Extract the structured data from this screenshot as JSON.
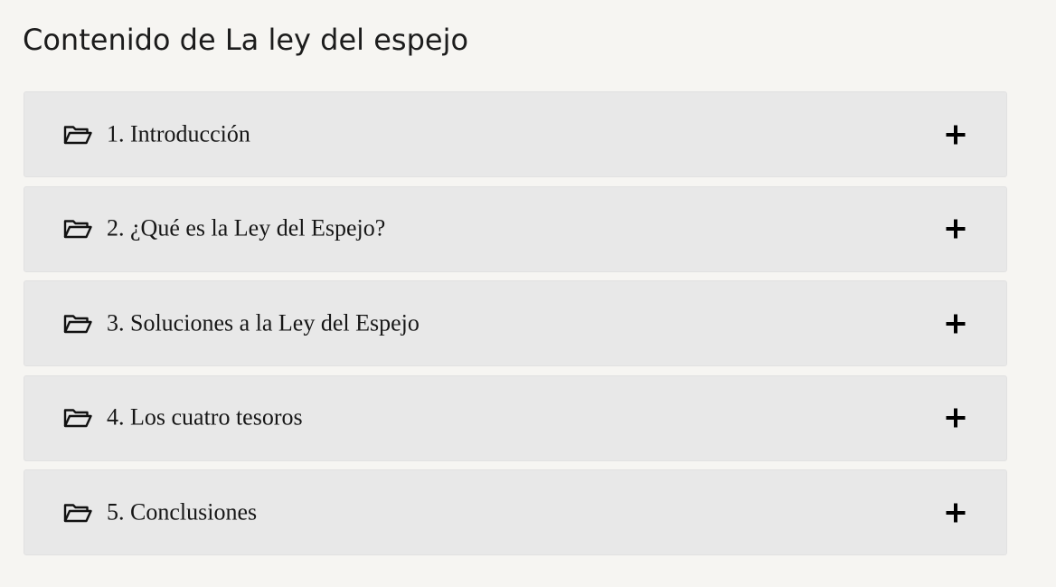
{
  "page_title": "Contenido de La ley del espejo",
  "accordion": {
    "items": [
      {
        "label": "1. Introducción",
        "icon": "folder-open-icon",
        "toggle_icon": "plus-icon"
      },
      {
        "label": "2. ¿Qué es la Ley del Espejo?",
        "icon": "folder-open-icon",
        "toggle_icon": "plus-icon"
      },
      {
        "label": "3. Soluciones a la Ley del Espejo",
        "icon": "folder-open-icon",
        "toggle_icon": "plus-icon"
      },
      {
        "label": "4. Los cuatro tesoros",
        "icon": "folder-open-icon",
        "toggle_icon": "plus-icon"
      },
      {
        "label": "5. Conclusiones",
        "icon": "folder-open-icon",
        "toggle_icon": "plus-icon"
      }
    ]
  },
  "colors": {
    "background": "#f6f5f2",
    "item_background": "#e8e8e8",
    "text": "#161616"
  }
}
